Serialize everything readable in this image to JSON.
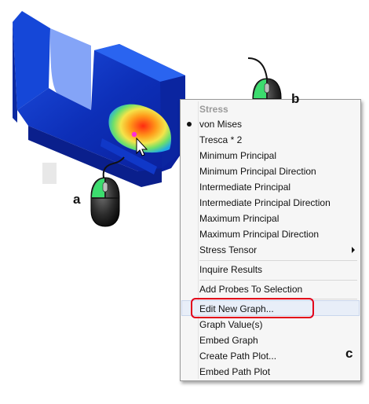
{
  "context_menu": {
    "header": "Stress",
    "items": [
      {
        "label": "von Mises",
        "checked": true
      },
      {
        "label": "Tresca * 2"
      },
      {
        "label": "Minimum Principal"
      },
      {
        "label": "Minimum Principal Direction"
      },
      {
        "label": "Intermediate Principal"
      },
      {
        "label": "Intermediate Principal Direction"
      },
      {
        "label": "Maximum Principal"
      },
      {
        "label": "Maximum Principal Direction"
      },
      {
        "label": "Stress Tensor",
        "submenu": true
      }
    ],
    "inquire": "Inquire Results",
    "add_probes": "Add Probes To Selection",
    "graph_items": [
      {
        "label": "Edit New Graph...",
        "highlighted": true
      },
      {
        "label": "Graph Value(s)"
      },
      {
        "label": "Embed Graph"
      },
      {
        "label": "Create Path Plot..."
      },
      {
        "label": "Embed Path Plot"
      }
    ]
  },
  "callouts": {
    "a": "a",
    "b": "b",
    "c": "c"
  },
  "icons": {
    "mouse": "mouse-icon",
    "cursor": "cursor-arrow-icon",
    "submenu": "chevron-right-icon",
    "checked": "bullet-icon"
  },
  "colors": {
    "stress_low": "#0a1ea8",
    "stress_mid": "#1f57e6",
    "stress_high": "#ff4a1a",
    "highlight_box": "#e2001a",
    "mouse_button": "#3cdc6e"
  }
}
